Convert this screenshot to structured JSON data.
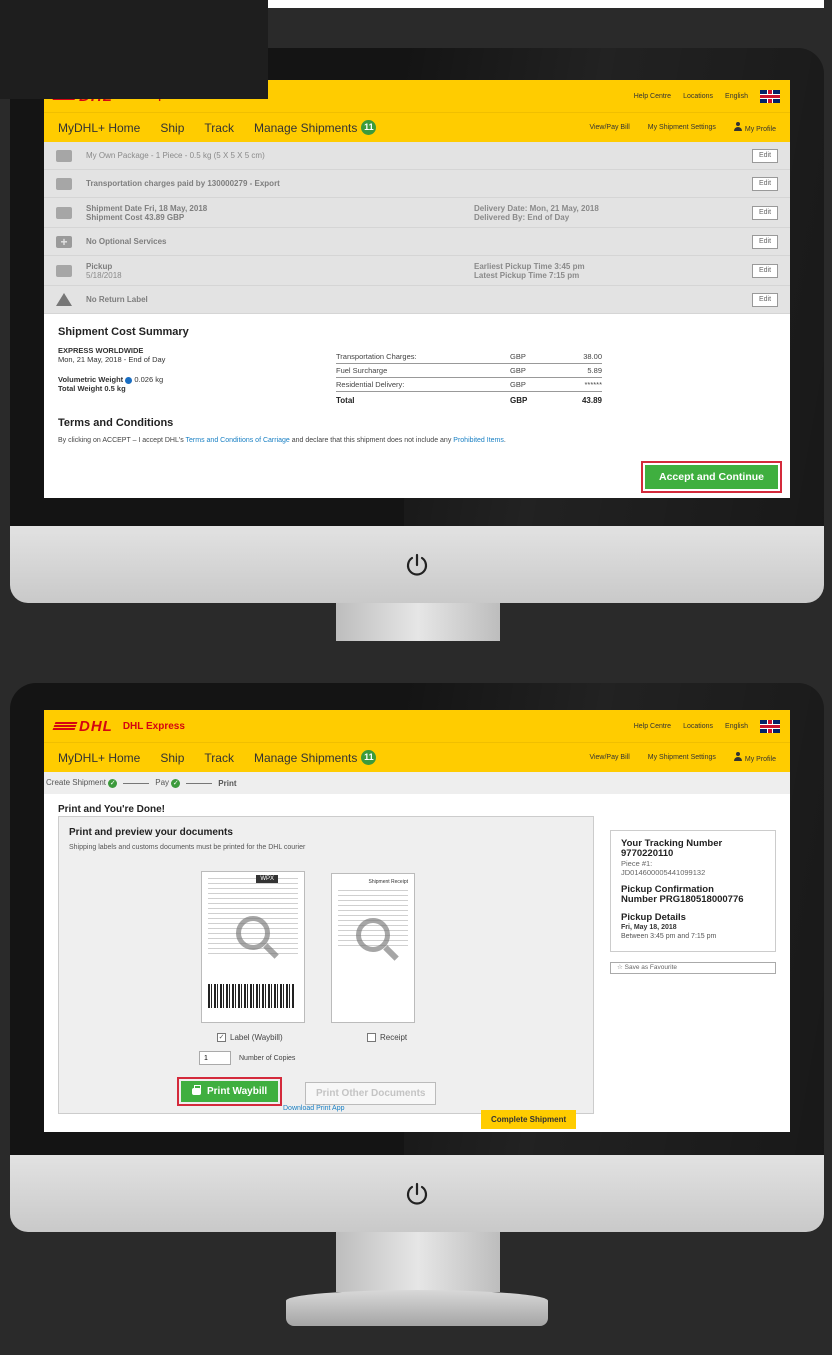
{
  "screen1": {
    "header": {
      "brand": "DHL Express",
      "logo_text": "DHL",
      "links": [
        "Help Centre",
        "Locations",
        "English"
      ]
    },
    "nav": {
      "items": [
        "MyDHL+ Home",
        "Ship",
        "Track",
        "Manage Shipments"
      ],
      "badge": "11",
      "right": [
        "View/Pay Bill",
        "My Shipment Settings",
        "My Profile"
      ]
    },
    "rows": [
      {
        "text": "My Own Package - 1 Piece - 0.5 kg (5 X 5 X 5 cm)",
        "mid": "",
        "mid2": "",
        "edit": "Edit"
      },
      {
        "text": "Transportation charges paid by 130000279 - Export",
        "mid": "",
        "mid2": "",
        "edit": "Edit"
      },
      {
        "text": "Shipment Date Fri, 18 May, 2018",
        "text2": "Shipment Cost 43.89 GBP",
        "mid": "Delivery Date: Mon, 21 May, 2018",
        "mid2": "Delivered By: End of Day",
        "edit": "Edit"
      },
      {
        "text": "No Optional Services",
        "mid": "",
        "mid2": "",
        "edit": "Edit"
      },
      {
        "text": "Pickup",
        "text2": "5/18/2018",
        "mid": "Earliest Pickup Time 3:45 pm",
        "mid2": "Latest Pickup Time 7:15 pm",
        "edit": "Edit"
      },
      {
        "text": "No Return Label",
        "mid": "",
        "mid2": "",
        "edit": "Edit"
      }
    ],
    "summary": {
      "title": "Shipment Cost Summary",
      "service": "EXPRESS WORLDWIDE",
      "delivery": "Mon, 21 May, 2018 - End of Day",
      "volumetric": "Volumetric Weight",
      "volumetric_value": "0.026 kg",
      "total_weight": "Total Weight 0.5 kg",
      "costs": [
        {
          "label": "Transportation Charges:",
          "currency": "GBP",
          "amount": "38.00"
        },
        {
          "label": "Fuel Surcharge",
          "currency": "GBP",
          "amount": "5.89"
        },
        {
          "label": "Residential Delivery:",
          "currency": "GBP",
          "amount": "******"
        }
      ],
      "total": {
        "label": "Total",
        "currency": "GBP",
        "amount": "43.89"
      }
    },
    "terms": {
      "title": "Terms and Conditions",
      "text_a": "By clicking on ACCEPT – I accept DHL's",
      "link_a": "Terms and Conditions of Carriage",
      "text_b": "and declare that this shipment does not include any",
      "link_b": "Prohibited Items",
      "text_c": "."
    },
    "accept_label": "Accept and Continue"
  },
  "screen2": {
    "header": {
      "brand": "DHL Express",
      "logo_text": "DHL",
      "links": [
        "Help Centre",
        "Locations",
        "English"
      ]
    },
    "nav": {
      "items": [
        "MyDHL+ Home",
        "Ship",
        "Track",
        "Manage Shipments"
      ],
      "badge": "11",
      "right": [
        "View/Pay Bill",
        "My Shipment Settings",
        "My Profile"
      ]
    },
    "steps": [
      "Create Shipment",
      "Pay",
      "Print"
    ],
    "title": "Print and You're Done!",
    "panel_title": "Print and preview your documents",
    "panel_sub": "Shipping labels and customs documents must be printed for the DHL courier",
    "label_checkbox": "Label (Waybill)",
    "receipt_checkbox": "Receipt",
    "waybill_tag": "WPX",
    "receipt_heading": "Shipment Receipt",
    "copies_value": "1",
    "copies_label": "Number of Copies",
    "print_waybill": "Print Waybill",
    "print_other": "Print Other Documents",
    "download_app": "Download Print App",
    "complete": "Complete Shipment",
    "tracking": {
      "heading": "Your Tracking Number",
      "number": "9770220110",
      "piece_label": "Piece #1:",
      "piece_id": "JD014600005441099132",
      "pickup_heading": "Pickup Confirmation",
      "pickup_number": "Number PRG180518000776",
      "details_heading": "Pickup Details",
      "details_date": "Fri, May 18, 2018",
      "details_window": "Between 3:45 pm and 7:15 pm"
    },
    "favourite": "☆  Save as Favourite"
  }
}
